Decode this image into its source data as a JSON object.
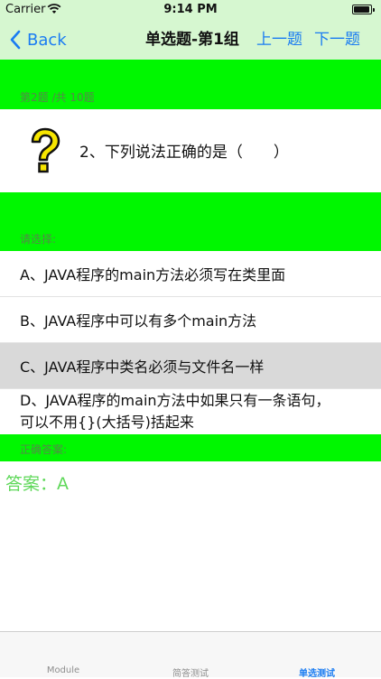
{
  "status_bar": {
    "carrier": "Carrier",
    "time": "9:14 PM"
  },
  "nav": {
    "back_label": "Back",
    "title": "单选题-第1组",
    "prev_label": "上一题",
    "next_label": "下一题"
  },
  "question": {
    "counter": "第2题 /共 10题",
    "text": "2、下列说法正确的是（　　）"
  },
  "choices_header": "请选择:",
  "options": [
    {
      "label": "A、JAVA程序的main方法必须写在类里面",
      "selected": false
    },
    {
      "label": "B、JAVA程序中可以有多个main方法",
      "selected": false
    },
    {
      "label": "C、JAVA程序中类名必须与文件名一样",
      "selected": true
    },
    {
      "line1": "D、JAVA程序的main方法中如果只有一条语句，",
      "line2": "可以不用{}(大括号)括起来",
      "selected": false
    }
  ],
  "answer_header": "正确答案:",
  "answer_text": "答案：A",
  "tabs": [
    {
      "label": "Module",
      "active": false
    },
    {
      "label": "简答测试",
      "active": false
    },
    {
      "label": "单选测试",
      "active": true
    }
  ],
  "colors": {
    "accent": "#1a7cf2",
    "band_green": "#00f700",
    "nav_bg": "#d6f7d0",
    "answer_green": "#5fd85a",
    "selected_bg": "#d9d9d9"
  },
  "icons": {
    "back": "chevron-left-icon",
    "question": "question-mark-icon",
    "wifi": "wifi-icon",
    "battery": "battery-icon"
  }
}
